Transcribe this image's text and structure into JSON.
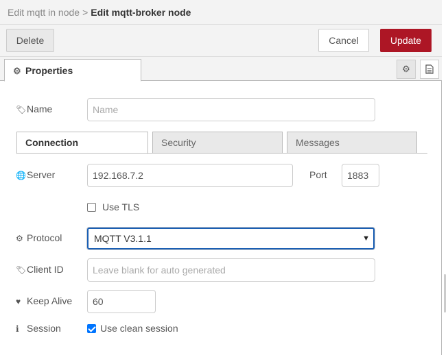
{
  "breadcrumb": {
    "parent": "Edit mqtt in node",
    "separator": ">",
    "current": "Edit mqtt-broker node"
  },
  "toolbar": {
    "delete_label": "Delete",
    "cancel_label": "Cancel",
    "update_label": "Update"
  },
  "tabs": {
    "properties_label": "Properties"
  },
  "icons": {
    "properties": "gear-icon",
    "settings": "gear-icon",
    "description": "document-icon",
    "name": "tag-icon",
    "server": "globe-icon",
    "protocol": "gear-icon",
    "client_id": "tag-icon",
    "keep_alive": "heartbeat-icon",
    "session": "info-icon"
  },
  "colors": {
    "accent": "#ad1625",
    "checkbox": "#0075ff",
    "select_focus": "#1a5fb4"
  },
  "form": {
    "name": {
      "label": "Name",
      "placeholder": "Name",
      "value": ""
    },
    "subtabs": [
      "Connection",
      "Security",
      "Messages"
    ],
    "server": {
      "label": "Server",
      "value": "192.168.7.2"
    },
    "port": {
      "label": "Port",
      "value": "1883"
    },
    "use_tls": {
      "label": "Use TLS",
      "checked": false
    },
    "protocol": {
      "label": "Protocol",
      "value": "MQTT V3.1.1"
    },
    "client_id": {
      "label": "Client ID",
      "placeholder": "Leave blank for auto generated",
      "value": ""
    },
    "keep_alive": {
      "label": "Keep Alive",
      "value": "60"
    },
    "session": {
      "label": "Session",
      "checkbox_label": "Use clean session",
      "checked": true
    }
  }
}
